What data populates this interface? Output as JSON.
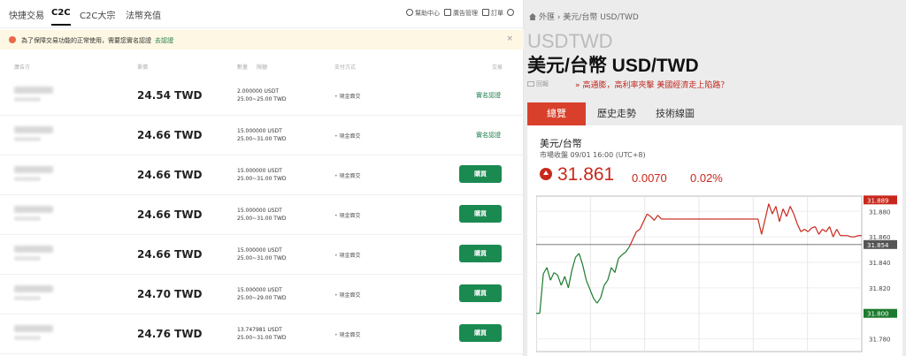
{
  "left": {
    "nav": {
      "tabs": [
        "快捷交易",
        "C2C",
        "C2C大宗",
        "法幣充值"
      ],
      "right_links": [
        "幫助中心",
        "廣告管理",
        "訂單",
        "設置"
      ]
    },
    "notice": {
      "text": "為了保障交易功能的正常使用，需要您實名認證",
      "link": "去認證"
    },
    "columns": [
      "廣告方",
      "單價",
      "數量",
      "限額",
      "支付方式",
      "交易"
    ],
    "rows": [
      {
        "price": "24.54 TWD",
        "amount": "2.000000 USDT",
        "limit": "25.00~25.00 TWD",
        "payment": "現金面交",
        "action": "verify"
      },
      {
        "price": "24.66 TWD",
        "amount": "15.000000 USDT",
        "limit": "25.00~31.00 TWD",
        "payment": "現金面交",
        "action": "verify"
      },
      {
        "price": "24.66 TWD",
        "amount": "15.000000 USDT",
        "limit": "25.00~31.00 TWD",
        "payment": "現金面交",
        "action": "buy"
      },
      {
        "price": "24.66 TWD",
        "amount": "15.000000 USDT",
        "limit": "25.00~31.00 TWD",
        "payment": "現金面交",
        "action": "buy"
      },
      {
        "price": "24.66 TWD",
        "amount": "15.000000 USDT",
        "limit": "25.00~31.00 TWD",
        "payment": "現金面交",
        "action": "buy"
      },
      {
        "price": "24.70 TWD",
        "amount": "15.000000 USDT",
        "limit": "25.00~29.00 TWD",
        "payment": "現金面交",
        "action": "buy"
      },
      {
        "price": "24.76 TWD",
        "amount": "13.747981 USDT",
        "limit": "25.00~31.00 TWD",
        "payment": "現金面交",
        "action": "buy"
      }
    ],
    "verify_label": "實名認證",
    "buy_label": "購買"
  },
  "right": {
    "breadcrumb": [
      "外匯",
      "美元/台幣 USD/TWD"
    ],
    "code": "USDTWD",
    "name": "美元/台幣 USD/TWD",
    "tools": "回報",
    "promo": "高通膨，高利率夾擊 美國經濟走上陷路？",
    "tabs": [
      "總覽",
      "歷史走勢",
      "技術線圖"
    ],
    "quote": {
      "name": "美元/台幣",
      "time": "市場收盤 09/01 16:00 (UTC+8)",
      "price": "31.861",
      "change": "0.0070",
      "change_pct": "0.02%"
    },
    "colors": {
      "up": "#c8281c",
      "down": "#1b7a2e",
      "accent": "#d9402b"
    }
  },
  "chart_data": {
    "type": "line",
    "ylim": [
      31.77,
      31.892
    ],
    "yticks": [
      31.78,
      31.8,
      31.82,
      31.84,
      31.86,
      31.88
    ],
    "markers": [
      {
        "label": "31.889",
        "value": 31.889,
        "color": "#c8281c"
      },
      {
        "label": "31.854",
        "value": 31.854,
        "color": "#555555"
      },
      {
        "label": "31.800",
        "value": 31.8,
        "color": "#1b7a2e"
      }
    ],
    "reference": 31.854,
    "values": [
      31.8,
      31.8,
      31.831,
      31.836,
      31.826,
      31.832,
      31.83,
      31.822,
      31.829,
      31.82,
      31.834,
      31.844,
      31.847,
      31.838,
      31.826,
      31.819,
      31.812,
      31.808,
      31.812,
      31.822,
      31.826,
      31.836,
      31.832,
      31.843,
      31.846,
      31.848,
      31.852,
      31.858,
      31.864,
      31.866,
      31.872,
      31.878,
      31.876,
      31.873,
      31.877,
      31.874,
      31.874,
      31.874,
      31.874,
      31.874,
      31.874,
      31.874,
      31.874,
      31.874,
      31.874,
      31.874,
      31.874,
      31.874,
      31.874,
      31.874,
      31.874,
      31.874,
      31.874,
      31.874,
      31.874,
      31.874,
      31.874,
      31.874,
      31.874,
      31.874,
      31.874,
      31.874,
      31.874,
      31.862,
      31.874,
      31.886,
      31.878,
      31.884,
      31.872,
      31.882,
      31.876,
      31.884,
      31.878,
      31.87,
      31.864,
      31.866,
      31.864,
      31.867,
      31.868,
      31.862,
      31.866,
      31.864,
      31.868,
      31.86,
      31.866,
      31.861,
      31.861,
      31.861,
      31.86,
      31.86,
      31.861,
      31.861
    ]
  }
}
